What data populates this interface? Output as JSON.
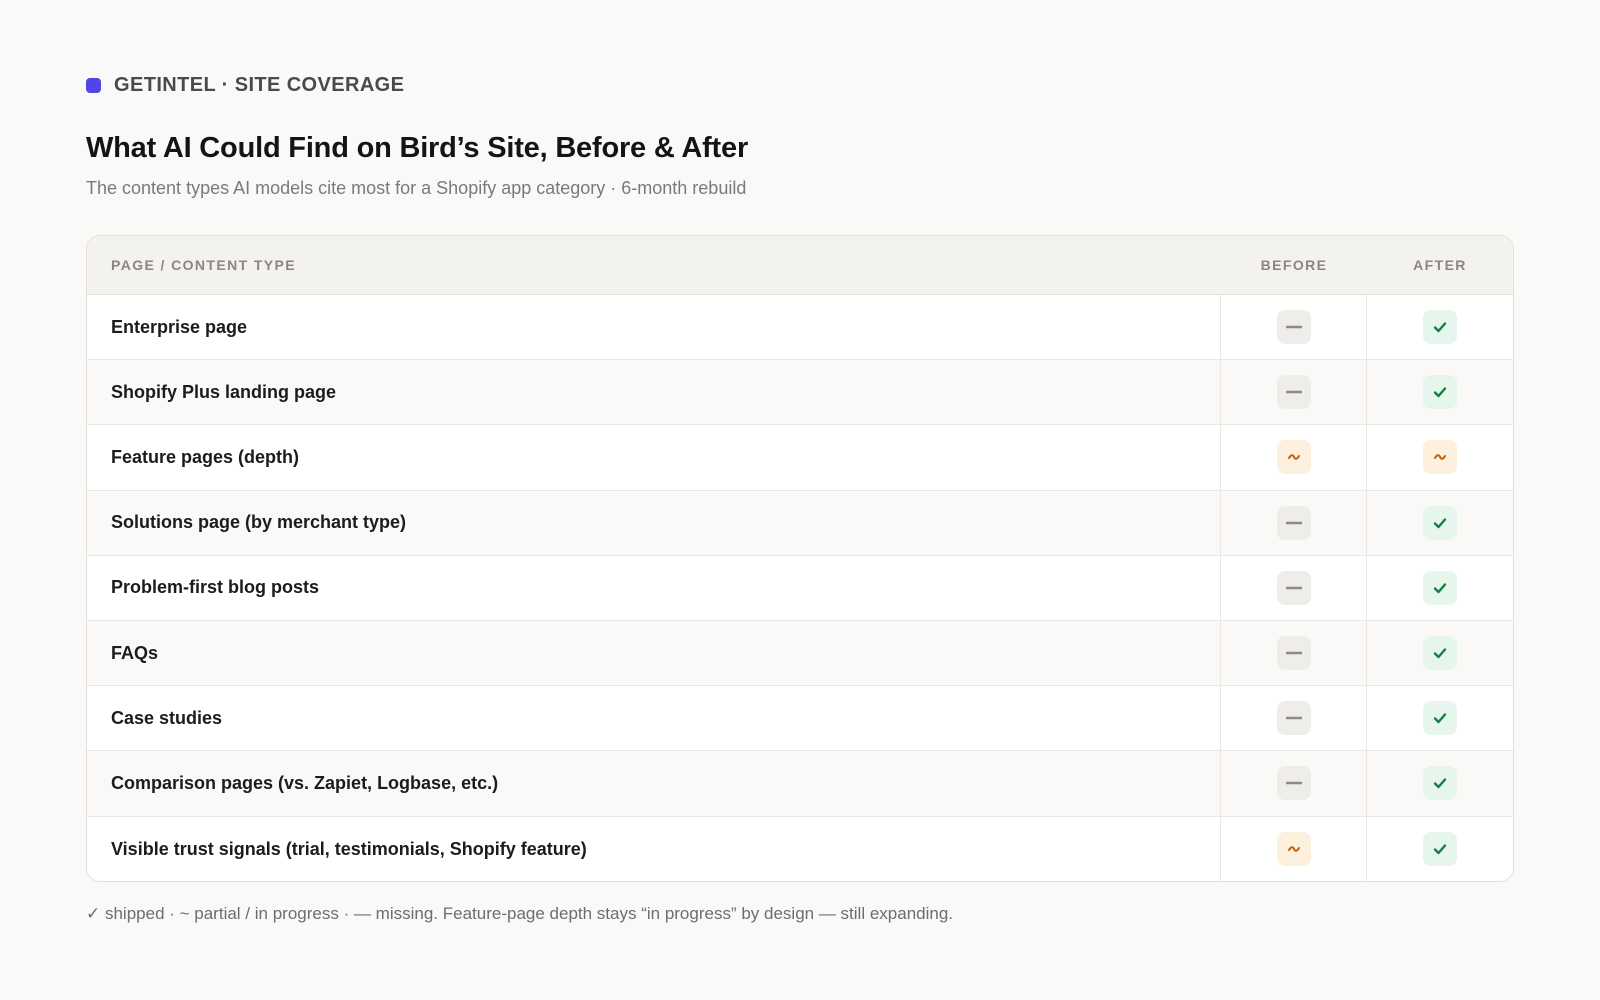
{
  "brand": {
    "text": "GETINTEL · SITE COVERAGE",
    "dot_color": "#4f46e5"
  },
  "title": "What AI Could Find on Bird’s Site, Before & After",
  "subtitle": "The content types AI models cite most for a Shopify app category · 6-month rebuild",
  "table": {
    "headers": {
      "type": "PAGE / CONTENT TYPE",
      "before": "BEFORE",
      "after": "AFTER"
    },
    "rows": [
      {
        "label": "Enterprise page",
        "before": "missing",
        "after": "shipped"
      },
      {
        "label": "Shopify Plus landing page",
        "before": "missing",
        "after": "shipped"
      },
      {
        "label": "Feature pages (depth)",
        "before": "partial",
        "after": "partial"
      },
      {
        "label": "Solutions page (by merchant type)",
        "before": "missing",
        "after": "shipped"
      },
      {
        "label": "Problem-first blog posts",
        "before": "missing",
        "after": "shipped"
      },
      {
        "label": "FAQs",
        "before": "missing",
        "after": "shipped"
      },
      {
        "label": "Case studies",
        "before": "missing",
        "after": "shipped"
      },
      {
        "label": "Comparison pages (vs. Zapiet, Logbase, etc.)",
        "before": "missing",
        "after": "shipped"
      },
      {
        "label": "Visible trust signals (trial, testimonials, Shopify feature)",
        "before": "partial",
        "after": "shipped"
      }
    ]
  },
  "status_colors": {
    "shipped": "#15803d",
    "partial": "#c2610c",
    "missing": "#8e8b87"
  },
  "footnote": "✓ shipped  ·  ~ partial / in progress  ·  — missing. Feature-page depth stays “in progress” by design — still expanding."
}
